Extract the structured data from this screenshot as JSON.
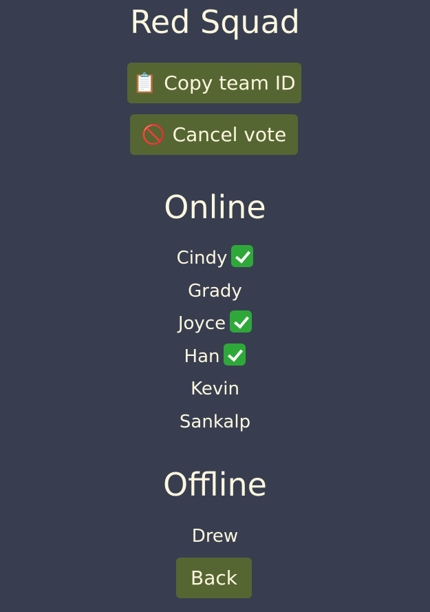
{
  "team": {
    "name": "Red Squad"
  },
  "buttons": {
    "copy": {
      "emoji": "📋",
      "label": "Copy team ID"
    },
    "cancel": {
      "emoji": "🚫",
      "label": "Cancel vote"
    },
    "back": {
      "label": "Back"
    }
  },
  "online": {
    "heading": "Online",
    "members": [
      {
        "name": "Cindy",
        "voted": true
      },
      {
        "name": "Grady",
        "voted": false
      },
      {
        "name": "Joyce",
        "voted": true
      },
      {
        "name": "Han",
        "voted": true
      },
      {
        "name": "Kevin",
        "voted": false
      },
      {
        "name": "Sankalp",
        "voted": false
      }
    ]
  },
  "offline": {
    "heading": "Offline",
    "members": [
      {
        "name": "Drew",
        "voted": false
      }
    ]
  },
  "colors": {
    "background": "#383e50",
    "button": "#566633",
    "text": "#fcf7de",
    "check": "#2fa83a"
  },
  "icons": {
    "copy": "clipboard-icon",
    "cancel": "prohibited-icon",
    "voted": "check-mark-icon"
  }
}
